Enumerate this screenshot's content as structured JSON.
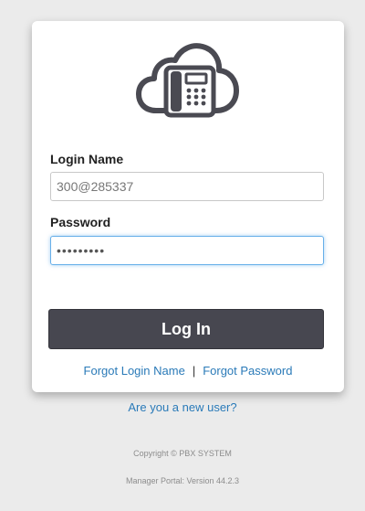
{
  "logo": {
    "icon": "cloud-phone-icon",
    "color": "#4a4a52"
  },
  "form": {
    "login_name_label": "Login Name",
    "login_name_value": "300@285337",
    "password_label": "Password",
    "password_value": "•••••••••",
    "login_button_label": "Log In"
  },
  "links": {
    "forgot_login_name": "Forgot Login Name",
    "separator": "|",
    "forgot_password": "Forgot Password",
    "new_user": "Are you a new user?"
  },
  "footer": {
    "copyright": "Copyright © PBX SYSTEM",
    "version": "Manager Portal: Version 44.2.3"
  },
  "colors": {
    "background": "#ebebeb",
    "card": "#ffffff",
    "button": "#474750",
    "link": "#2a7ab8",
    "focus_border": "#66afe9"
  }
}
